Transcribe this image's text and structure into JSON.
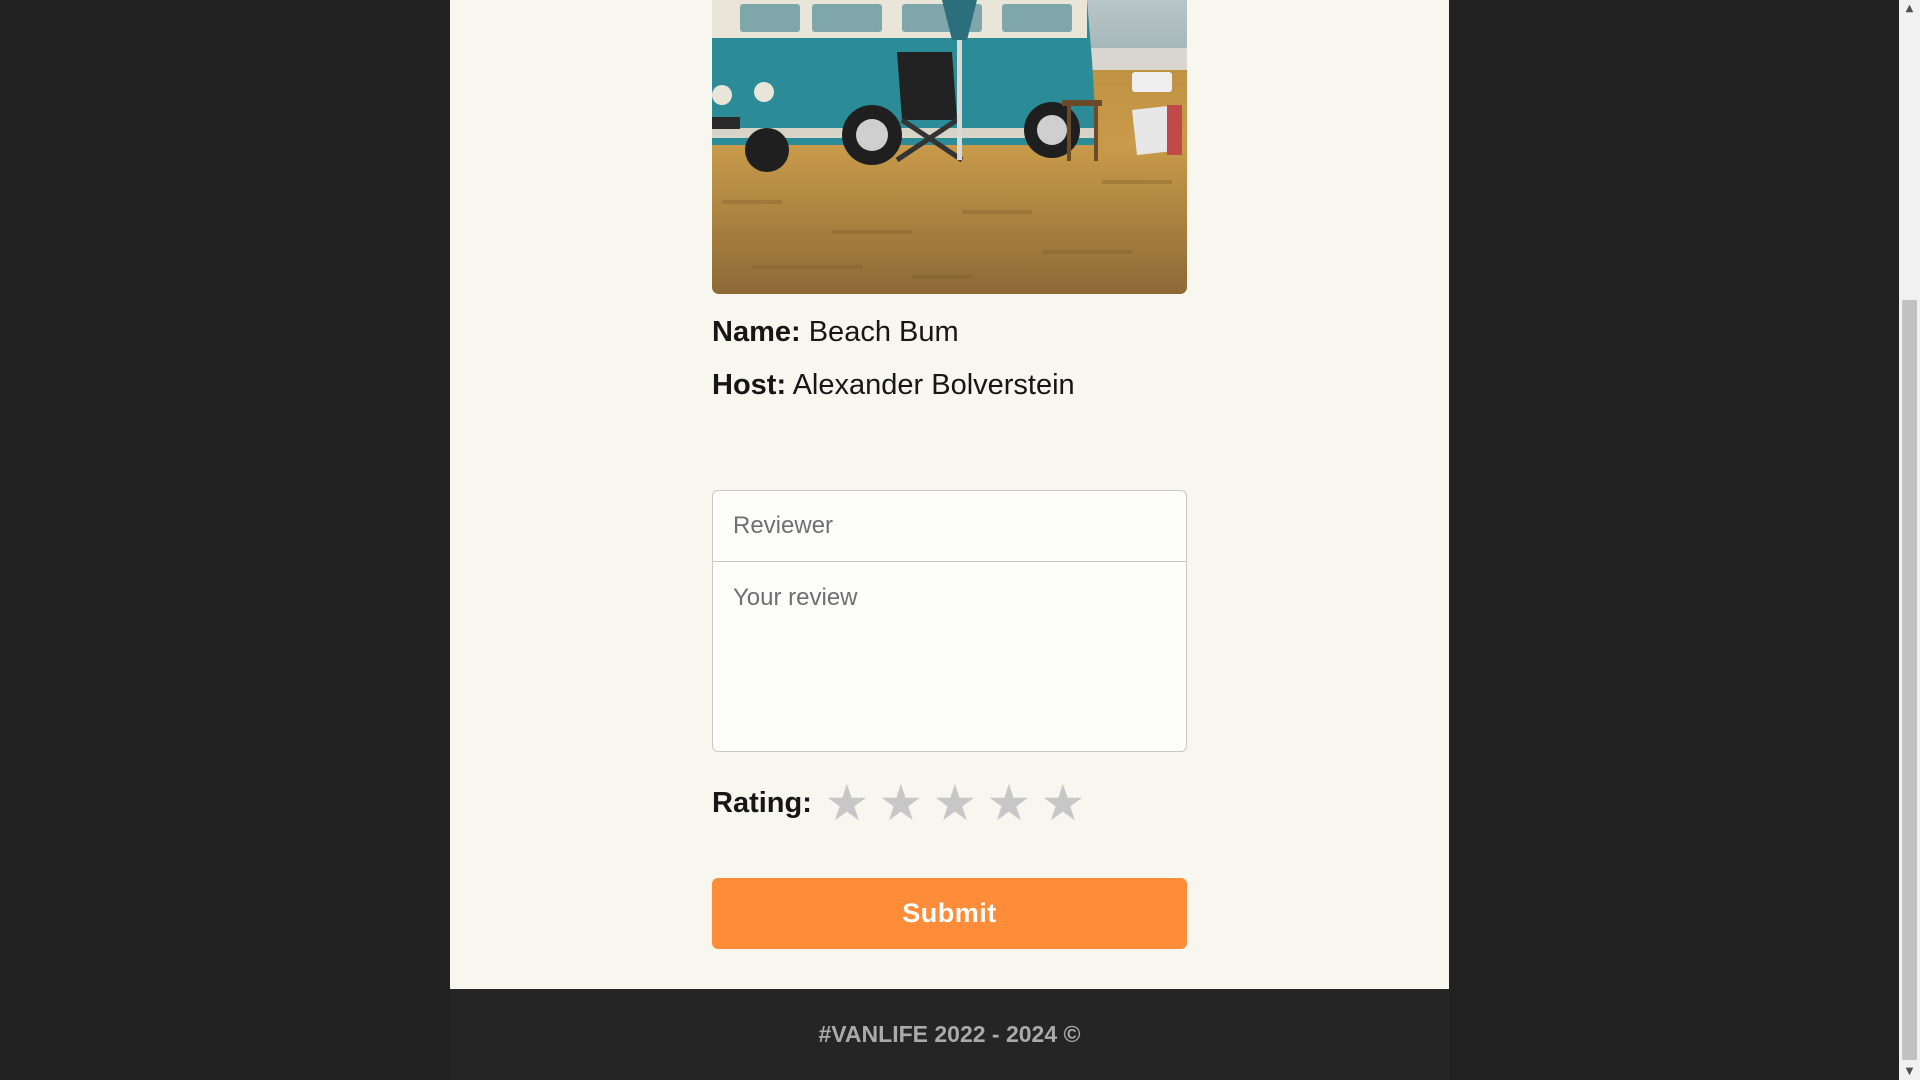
{
  "van": {
    "name_label": "Name:",
    "name_value": "Beach Bum",
    "host_label": "Host:",
    "host_value": "Alexander Bolverstein",
    "image": {
      "alt": "Teal vintage camper van parked on a grassy field with a folding chair",
      "icon": "van-photo"
    }
  },
  "form": {
    "reviewer_placeholder": "Reviewer",
    "review_placeholder": "Your review",
    "rating_label": "Rating:",
    "stars": [
      "★",
      "★",
      "★",
      "★",
      "★"
    ],
    "rating_value": 0,
    "rating_max": 5,
    "submit_label": "Submit"
  },
  "footer": {
    "text": "#VANLIFE 2022 - 2024 ©"
  },
  "colors": {
    "page_background": "#F7F6EF",
    "outer_background": "#222222",
    "accent": "#FF8C38",
    "star_inactive": "#C7C7C7",
    "footer_text": "#AAAAAA"
  },
  "scrollbar": {
    "up_arrow": "▲",
    "down_arrow": "▼"
  }
}
